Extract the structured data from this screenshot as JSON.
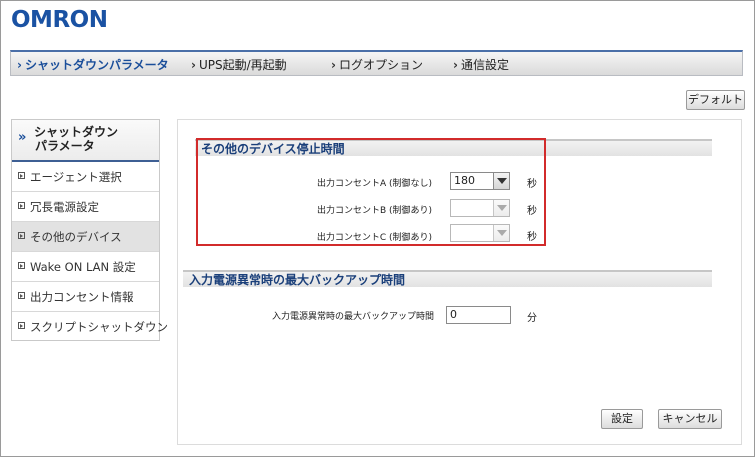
{
  "logo": "OMRON",
  "top_nav": {
    "tabs": [
      {
        "label": "シャットダウンパラメータ",
        "active": true
      },
      {
        "label": "UPS起動/再起動",
        "active": false
      },
      {
        "label": "ログオプション",
        "active": false
      },
      {
        "label": "通信設定",
        "active": false
      }
    ]
  },
  "default_button": "デフォルト",
  "sidebar": {
    "title_line1": "シャットダウン",
    "title_line2": "パラメータ",
    "items": [
      {
        "label": "エージェント選択",
        "active": false
      },
      {
        "label": "冗長電源設定",
        "active": false
      },
      {
        "label": "その他のデバイス",
        "active": true
      },
      {
        "label": "Wake ON LAN 設定",
        "active": false
      },
      {
        "label": "出力コンセント情報",
        "active": false
      },
      {
        "label": "スクリプトシャットダウン",
        "active": false
      }
    ]
  },
  "section1": {
    "title": "その他のデバイス停止時間",
    "rows": [
      {
        "label": "出力コンセントA (制御なし)",
        "value": "180",
        "unit": "秒",
        "enabled": true
      },
      {
        "label": "出力コンセントB (制御あり)",
        "value": "",
        "unit": "秒",
        "enabled": false
      },
      {
        "label": "出力コンセントC (制御あり)",
        "value": "",
        "unit": "秒",
        "enabled": false
      }
    ]
  },
  "section2": {
    "title": "入力電源異常時の最大バックアップ時間",
    "label": "入力電源異常時の最大バックアップ時間",
    "value": "0",
    "unit": "分"
  },
  "buttons": {
    "save": "設定",
    "cancel": "キャンセル"
  },
  "colors": {
    "brand": "#1a52a3",
    "highlight_border": "#d22b2b"
  }
}
